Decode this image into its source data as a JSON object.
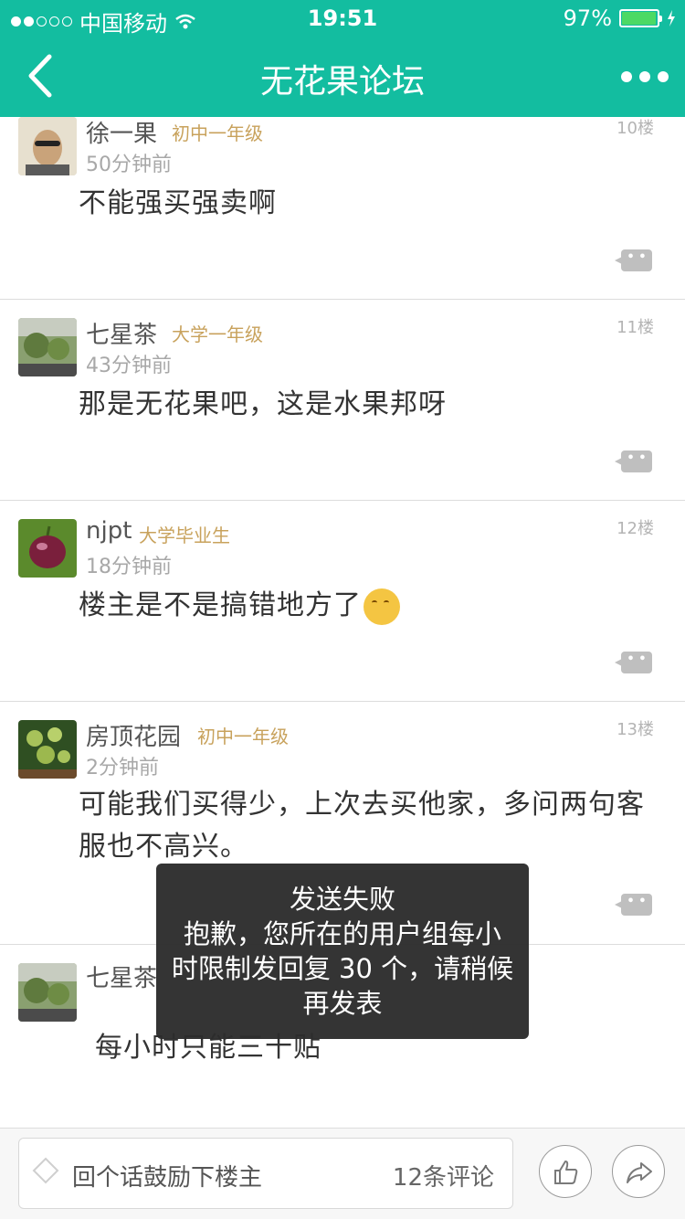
{
  "status_bar": {
    "carrier": "中国移动",
    "time": "19:51",
    "battery": "97%",
    "battery_level": 0.97
  },
  "header": {
    "title": "无花果论坛",
    "back_icon": "chevron-left-icon",
    "more_icon": "more-dots-icon"
  },
  "posts": [
    {
      "name": "徐一果",
      "level": "初中一年级",
      "time": "50分钟前",
      "floor": "10楼",
      "content": "不能强买强卖啊"
    },
    {
      "name": "七星茶",
      "level": "大学一年级",
      "time": "43分钟前",
      "floor": "11楼",
      "content": "那是无花果吧，这是水果邦呀"
    },
    {
      "name": "njpt",
      "level": "大学毕业生",
      "time": "18分钟前",
      "floor": "12楼",
      "content": "楼主是不是搞错地方了"
    },
    {
      "name": "房顶花园",
      "level": "初中一年级",
      "time": "2分钟前",
      "floor": "13楼",
      "content": "可能我们买得少，上次去买他家，多问两句客服也不高兴。"
    },
    {
      "name": "七星茶",
      "level": "",
      "time": "",
      "floor": "",
      "content": "每小时只能三十贴"
    }
  ],
  "toast": {
    "line1": "发送失败",
    "line2": "抱歉，您所在的用户组每小",
    "line3": "时限制发回复 30 个，请稍候",
    "line4": "再发表"
  },
  "bottom_bar": {
    "placeholder": "回个话鼓励下楼主",
    "comment_count": "12条评论",
    "like_icon": "thumbs-up-icon",
    "share_icon": "share-icon"
  },
  "colors": {
    "accent": "#13bda0",
    "level": "#c8a25c",
    "toast_bg": "#2c2c2c"
  }
}
